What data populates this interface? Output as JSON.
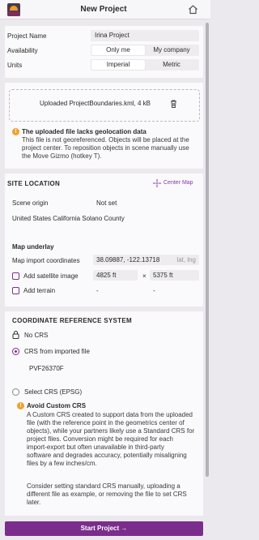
{
  "header": {
    "title": "New Project"
  },
  "project": {
    "name_label": "Project Name",
    "name_value": "Irina Project",
    "availability_label": "Availability",
    "availability_options": [
      "Only me",
      "My company"
    ],
    "units_label": "Units",
    "units_options": [
      "Imperial",
      "Metric"
    ]
  },
  "upload": {
    "file_text": "Uploaded ProjectBoundaries.kml, 4 kB",
    "warning_title": "The uploaded file lacks geolocation data",
    "warning_lines": [
      "This file is not georeferenced. Objects will be placed at the",
      "project center. To reposition objects in scene manually use",
      "the Move Gizmo (hotkey T)."
    ]
  },
  "site": {
    "heading": "SITE LOCATION",
    "center_map": "Center Map",
    "origin_label": "Scene origin",
    "origin_value": "Not set",
    "location_text": "United States California Solano County",
    "underlay_heading": "Map underlay",
    "coords_label": "Map import coordinates",
    "coords_value": "38.09887, -122.13718",
    "coords_unit": "lat, lng",
    "satellite_label": "Add satellite image",
    "satellite_w": "4825 ft",
    "times": "×",
    "satellite_h": "5375 ft",
    "terrain_label": "Add terrain",
    "terrain_w": "-",
    "terrain_h": "-"
  },
  "crs": {
    "heading": "COORDINATE REFERENCE SYSTEM",
    "no_crs": "No CRS",
    "imported_label": "CRS from imported file",
    "imported_value": "PVF26370F",
    "select_label": "Select CRS (EPSG)",
    "avoid_title": "Avoid Custom CRS",
    "avoid_lines": [
      "A Custom CRS created to support data from the uploaded",
      "file (with the reference point in the geometrics center of",
      "objects), while your partners likely use a Standard CRS for",
      "project files. Conversion might be required for each",
      "import-export but often unavailable in third-party",
      "software and degrades accuracy, potentially misaligning",
      "files by a few inches/cm."
    ],
    "avoid_lines_2": [
      "Consider setting standard CRS manually, uploading a",
      "different file as example, or removing the file to set CRS",
      "later."
    ]
  },
  "footer": {
    "start_label": "Start Project →"
  },
  "colors": {
    "accent": "#7b2d8c",
    "warning": "#f0a12e",
    "background": "#ece9ee"
  }
}
